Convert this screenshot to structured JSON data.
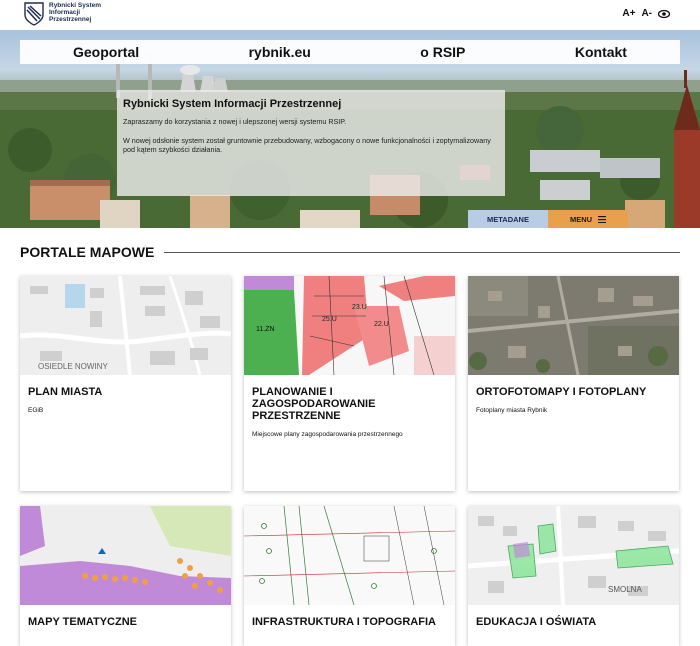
{
  "header": {
    "logo_text": "Rybnicki System Informacji Przestrzennej",
    "font_increase": "A+",
    "font_decrease": "A-"
  },
  "nav": {
    "items": [
      "Geoportal",
      "rybnik.eu",
      "o RSIP",
      "Kontakt"
    ]
  },
  "hero": {
    "title": "Rybnicki System Informacji Przestrzennej",
    "paragraph1": "Zapraszamy do korzystania z nowej i ulepszonej wersji systemu RSIP.",
    "paragraph2": "W nowej odsłonie system został gruntownie przebudowany, wzbogacony o nowe funkcjonalności i zoptymalizowany pod kątem szybkości działania.",
    "metadata_button": "METADANE",
    "menu_button": "MENU"
  },
  "section": {
    "title": "PORTALE MAPOWE"
  },
  "cards": [
    {
      "title": "PLAN MIASTA",
      "subtitle": "EGiB",
      "map_label": "OSIEDLE NOWINY"
    },
    {
      "title": "PLANOWANIE I ZAGOSPODAROWANIE PRZESTRZENNE",
      "subtitle": "Miejscowe plany zagospodarowania przestrzennego"
    },
    {
      "title": "ORTOFOTOMAPY I FOTOPLANY",
      "subtitle": "Fotoplany miasta Rybnik"
    },
    {
      "title": "MAPY TEMATYCZNE",
      "subtitle": ""
    },
    {
      "title": "INFRASTRUKTURA I TOPOGRAFIA",
      "subtitle": ""
    },
    {
      "title": "EDUKACJA I OŚWIATA",
      "subtitle": "",
      "map_label": "SMOLNA"
    }
  ],
  "colors": {
    "metadata_bg": "#b9cce6",
    "menu_bg": "#e8a04a",
    "planning_red": "#f08080",
    "planning_green": "#4caf50",
    "thematic_purple": "#c08ad8"
  }
}
